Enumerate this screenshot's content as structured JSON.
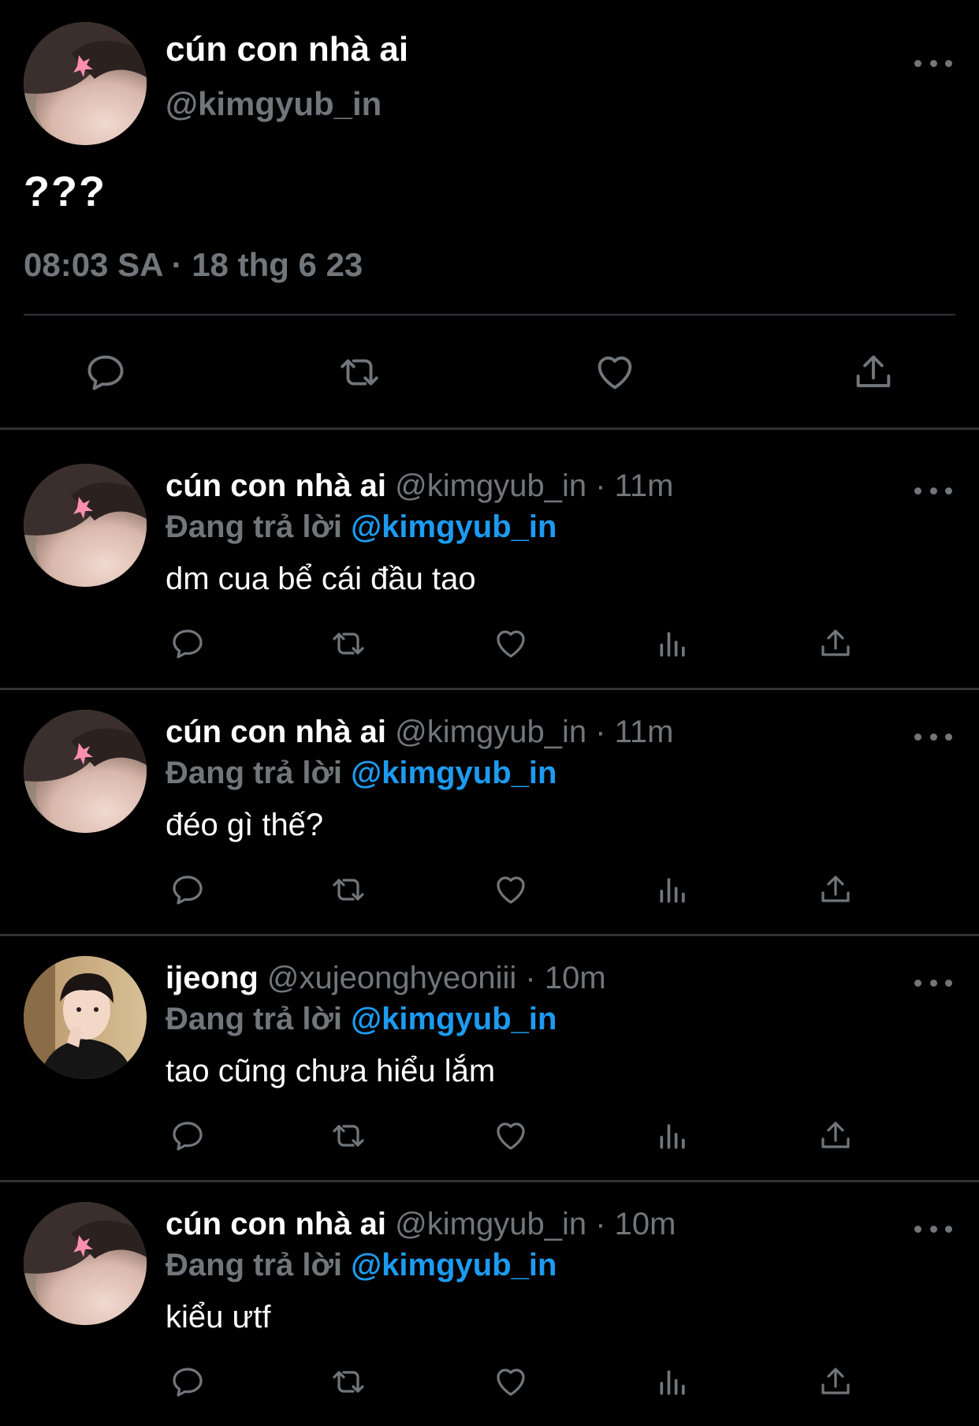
{
  "main_tweet": {
    "display_name": "cún con nhà ai",
    "handle": "@kimgyub_in",
    "text": "???",
    "timestamp": "08:03 SA · 18 thg 6 23",
    "avatar_icon": "avatar-photo",
    "actions": [
      "reply-icon",
      "retweet-icon",
      "like-icon",
      "share-icon"
    ]
  },
  "replies": [
    {
      "display_name": "cún con nhà ai",
      "meta": "@kimgyub_in · 11m",
      "replying_prefix": "Đang trả lời",
      "replying_to": "@kimgyub_in",
      "text": "dm cua bể cái đầu tao"
    },
    {
      "display_name": "cún con nhà ai",
      "meta": "@kimgyub_in · 11m",
      "replying_prefix": "Đang trả lời",
      "replying_to": "@kimgyub_in",
      "text": "đéo gì thế?"
    },
    {
      "display_name": "ijeong",
      "meta": "@xujeonghyeoniii · 10m",
      "replying_prefix": "Đang trả lời",
      "replying_to": "@kimgyub_in",
      "text": "tao cũng chưa hiểu lắm"
    },
    {
      "display_name": "cún con nhà ai",
      "meta": "@kimgyub_in · 10m",
      "replying_prefix": "Đang trả lời",
      "replying_to": "@kimgyub_in",
      "text": "kiểu ưtf"
    }
  ],
  "colors": {
    "background": "#000000",
    "text": "#ffffff",
    "muted": "#71767b",
    "link": "#1d9bf0",
    "divider": "#2f3336"
  }
}
